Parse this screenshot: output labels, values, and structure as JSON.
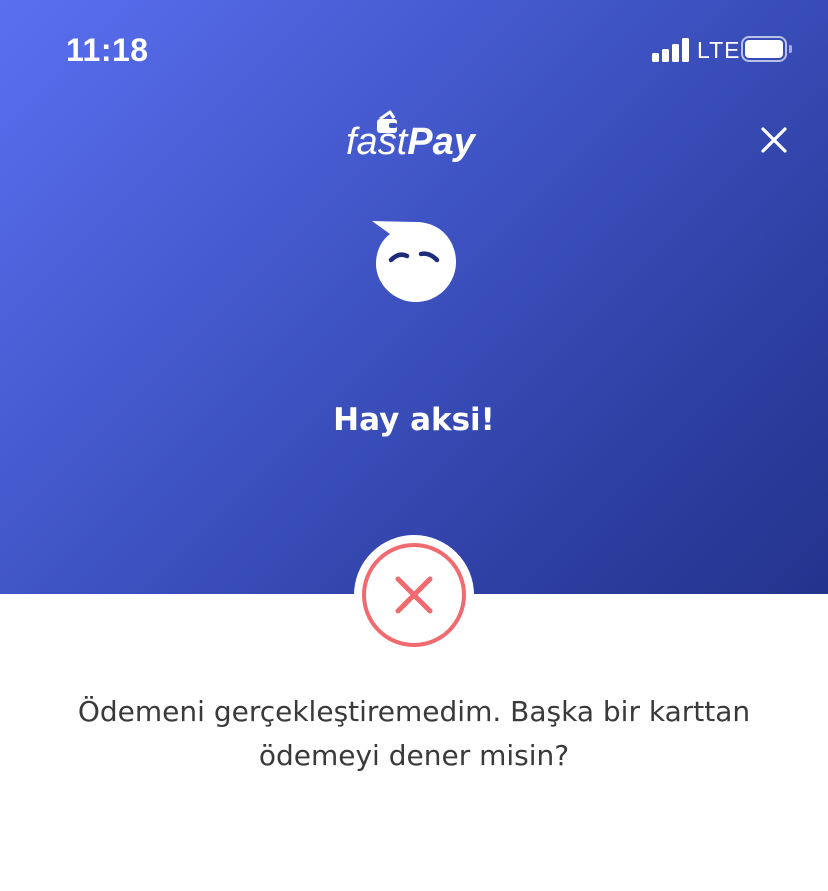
{
  "status_bar": {
    "time": "11:18",
    "network": "LTE",
    "signal_bars": 4,
    "battery_level": 1.0
  },
  "header": {
    "logo_light": "fast",
    "logo_bold": "Pay",
    "close_icon": "close-icon"
  },
  "hero": {
    "mascot_icon": "sad-speech-bubble-icon",
    "headline": "Hay aksi!"
  },
  "error": {
    "icon": "error-x-icon",
    "message_line1": "Ödemeni gerçekleştiremedim. Başka bir karttan",
    "message_line2": "ödemeyi dener misin?"
  },
  "colors": {
    "gradient_start": "#5a6ff0",
    "gradient_end": "#24338d",
    "error_red": "#f06a6f",
    "text_dark": "#3a3a3a"
  }
}
